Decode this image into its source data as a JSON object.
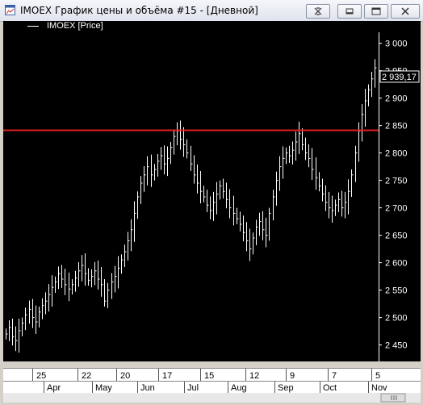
{
  "window": {
    "title": "IMOEX График цены и объёма #15 - [Дневной]"
  },
  "legend": {
    "label": "IMOEX [Price]"
  },
  "price_label": "2 939,17",
  "colors": {
    "background": "#000000",
    "bars": "#ffffff",
    "resistance": "#e02020"
  },
  "chart_data": {
    "type": "bar",
    "title": "",
    "series": [
      {
        "name": "IMOEX [Price]"
      }
    ],
    "ylim": [
      2420,
      3020
    ],
    "y_ticks": [
      "3 000",
      "2 950",
      "2 900",
      "2 850",
      "2 800",
      "2 750",
      "2 700",
      "2 650",
      "2 600",
      "2 550",
      "2 500",
      "2 450"
    ],
    "y_tick_values": [
      3000,
      2950,
      2900,
      2850,
      2800,
      2750,
      2700,
      2650,
      2600,
      2550,
      2500,
      2450
    ],
    "horizontal_line": 2842,
    "current_price": 2939.17,
    "x_day_labels": [
      "25",
      "22",
      "20",
      "17",
      "15",
      "12",
      "9",
      "7",
      "5"
    ],
    "x_month_labels": [
      "Apr",
      "May",
      "Jun",
      "Jul",
      "Aug",
      "Sep",
      "Oct",
      "Nov"
    ],
    "closes": [
      2470,
      2482,
      2465,
      2458,
      2476,
      2490,
      2505,
      2515,
      2500,
      2492,
      2510,
      2522,
      2530,
      2542,
      2555,
      2565,
      2580,
      2570,
      2560,
      2552,
      2560,
      2572,
      2585,
      2595,
      2580,
      2568,
      2575,
      2585,
      2570,
      2560,
      2530,
      2550,
      2565,
      2575,
      2590,
      2605,
      2620,
      2640,
      2660,
      2690,
      2720,
      2745,
      2760,
      2775,
      2760,
      2770,
      2785,
      2795,
      2780,
      2790,
      2810,
      2830,
      2840,
      2825,
      2815,
      2800,
      2780,
      2760,
      2745,
      2730,
      2720,
      2705,
      2695,
      2710,
      2725,
      2740,
      2730,
      2715,
      2700,
      2690,
      2680,
      2670,
      2655,
      2640,
      2625,
      2645,
      2665,
      2675,
      2660,
      2650,
      2690,
      2720,
      2750,
      2775,
      2790,
      2800,
      2795,
      2805,
      2820,
      2835,
      2815,
      2800,
      2790,
      2770,
      2755,
      2740,
      2725,
      2710,
      2700,
      2695,
      2705,
      2715,
      2700,
      2710,
      2730,
      2760,
      2800,
      2840,
      2870,
      2895,
      2915,
      2935,
      2955
    ]
  }
}
